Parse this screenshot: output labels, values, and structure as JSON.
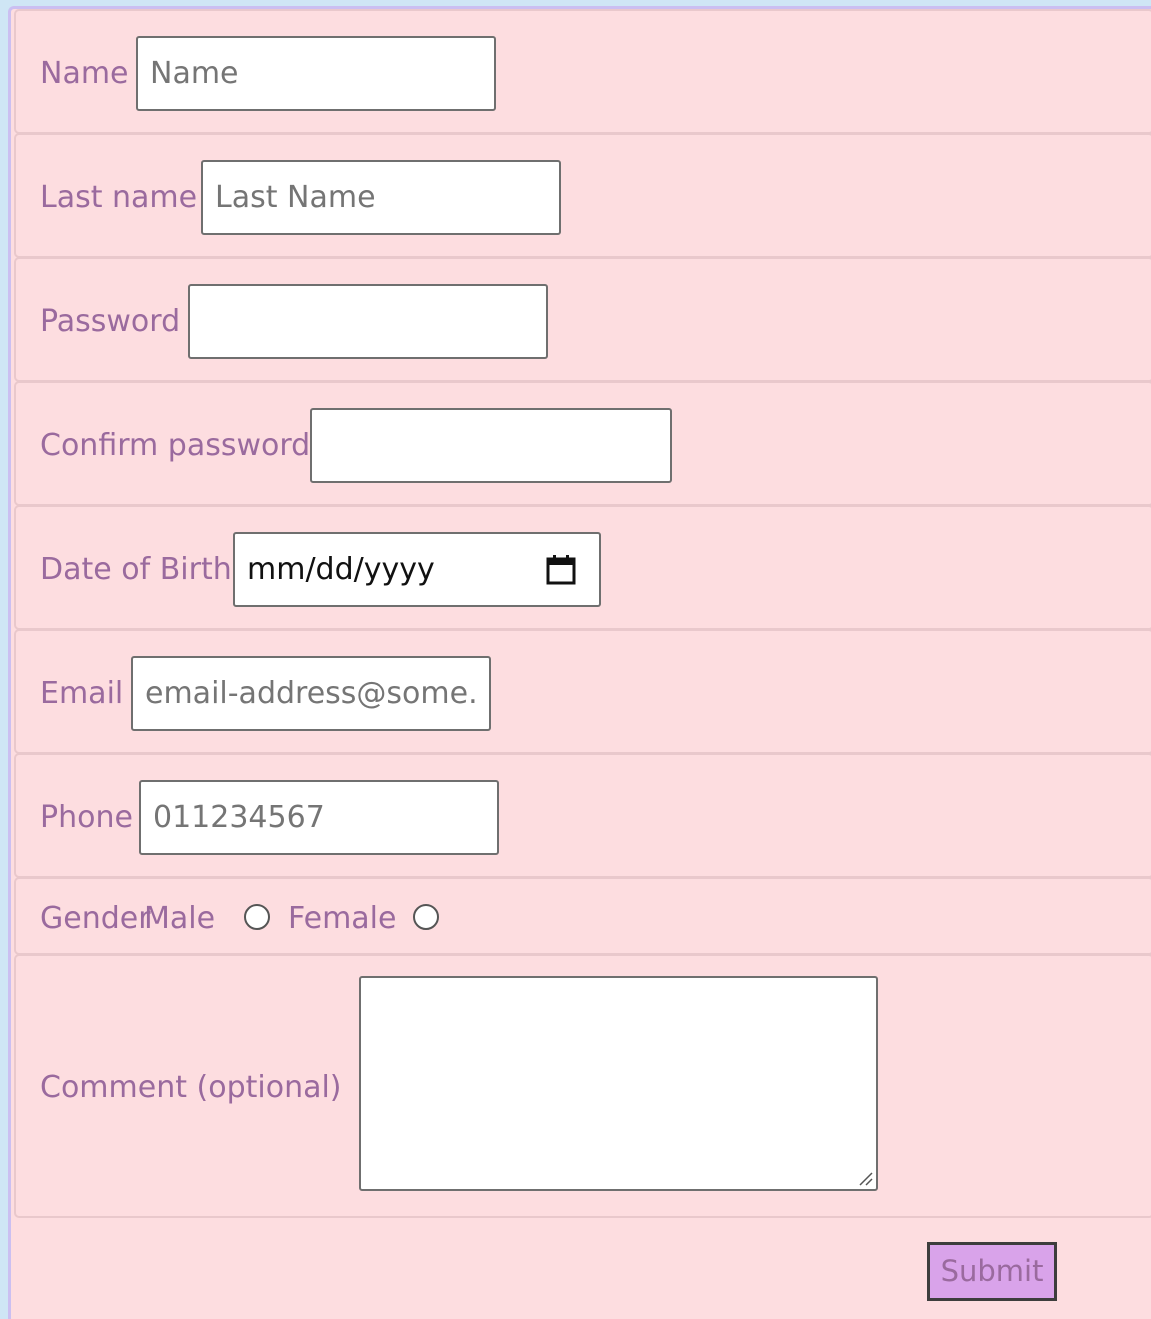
{
  "form": {
    "name": {
      "label": "Name",
      "placeholder": "Name"
    },
    "last_name": {
      "label": "Last name",
      "placeholder": "Last Name"
    },
    "password": {
      "label": "Password"
    },
    "confirm_password": {
      "label": "Confirm password"
    },
    "dob": {
      "label": "Date of Birth",
      "placeholder": "mm/dd/yyyy",
      "icon": "calendar-icon"
    },
    "email": {
      "label": "Email",
      "placeholder": "email-address@some.m"
    },
    "phone": {
      "label": "Phone",
      "placeholder": "011234567"
    },
    "gender": {
      "label": "Gender",
      "options": [
        "Male",
        "Female"
      ]
    },
    "comment": {
      "label": "Comment (optional)"
    },
    "submit_label": "Submit"
  },
  "colors": {
    "form_bg": "#fddde0",
    "label_text": "#9a6a9e",
    "submit_bg": "#d9a3ea",
    "page_bg": "#cfe6f5"
  }
}
